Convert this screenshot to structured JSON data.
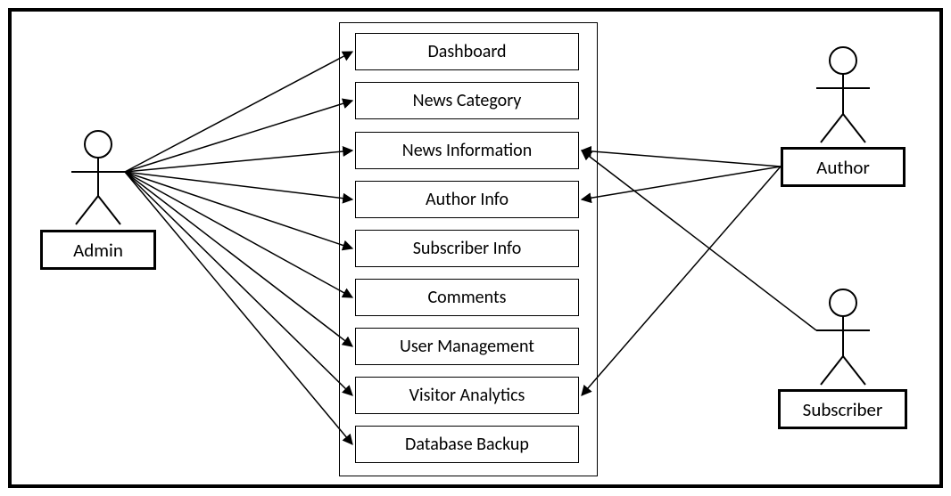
{
  "actors": {
    "admin": "Admin",
    "author": "Author",
    "subscriber": "Subscriber"
  },
  "usecases": [
    "Dashboard",
    "News Category",
    "News Information",
    "Author Info",
    "Subscriber Info",
    "Comments",
    "User Management",
    "Visitor Analytics",
    "Database Backup"
  ],
  "connections": {
    "admin": [
      "Dashboard",
      "News Category",
      "News Information",
      "Author Info",
      "Subscriber Info",
      "Comments",
      "User Management",
      "Visitor Analytics",
      "Database Backup"
    ],
    "author": [
      "News Information",
      "Author Info",
      "Visitor Analytics"
    ],
    "subscriber": [
      "News Information"
    ]
  }
}
